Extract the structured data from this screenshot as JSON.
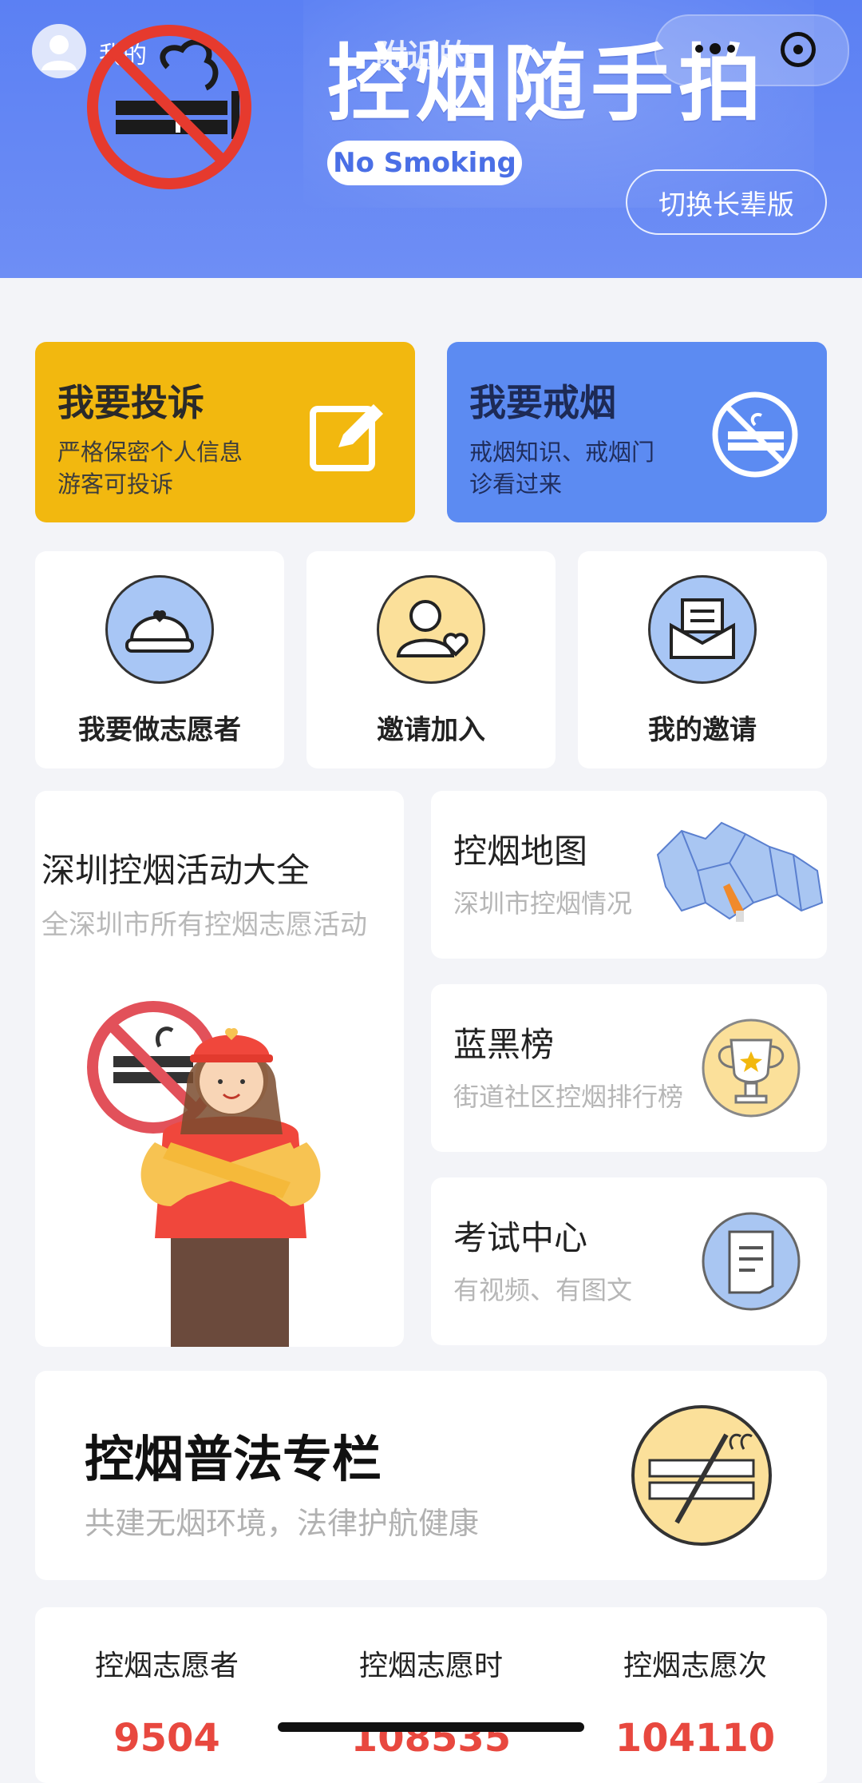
{
  "header": {
    "me_label": "我的",
    "title": "控烟随手拍",
    "title_overlay": "附近的",
    "no_smoking_pill": "No Smoking",
    "elder_mode_button": "切换长辈版",
    "colors": {
      "header_bg": "#5b80f3",
      "pill_text": "#4a6fe6"
    }
  },
  "feature_cards": {
    "complain": {
      "title": "我要投诉",
      "sub_line1": "严格保密个人信息",
      "sub_line2": "游客可投诉",
      "icon": "edit-icon",
      "color": "#f2b80f"
    },
    "quit": {
      "title": "我要戒烟",
      "sub_line1": "戒烟知识、戒烟门",
      "sub_line2": "诊看过来",
      "icon": "no-smoking-icon",
      "color": "#5c8bf2"
    }
  },
  "quick_actions": [
    {
      "label": "我要做志愿者",
      "icon": "volunteer-cap-icon"
    },
    {
      "label": "邀请加入",
      "icon": "invite-user-icon"
    },
    {
      "label": "我的邀请",
      "icon": "invitation-envelope-icon"
    }
  ],
  "activity": {
    "title": "深圳控烟活动大全",
    "subtitle": "全深圳市所有控烟志愿活动"
  },
  "side_cards": [
    {
      "title": "控烟地图",
      "subtitle": "深圳市控烟情况",
      "icon": "map-icon"
    },
    {
      "title": "蓝黑榜",
      "subtitle": "街道社区控烟排行榜",
      "icon": "trophy-icon"
    },
    {
      "title": "考试中心",
      "subtitle": "有视频、有图文",
      "icon": "document-icon"
    }
  ],
  "law_column": {
    "title": "控烟普法专栏",
    "subtitle": "共建无烟环境，法律护航健康",
    "icon": "no-cigarette-icon"
  },
  "stats": [
    {
      "label": "控烟志愿者",
      "value": "9504"
    },
    {
      "label": "控烟志愿时",
      "value": "108535"
    },
    {
      "label": "控烟志愿次",
      "value": "104110"
    }
  ]
}
